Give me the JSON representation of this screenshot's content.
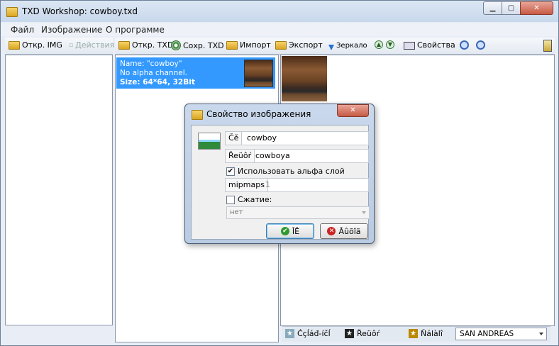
{
  "window": {
    "title": "TXD Workshop: cowboy.txd"
  },
  "menu": [
    "Файл",
    "Изображение",
    "О программе"
  ],
  "left_toolbar": {
    "open_img": "Откр. IMG",
    "actions": "Действия"
  },
  "main_toolbar": {
    "open_txd": "Откр. TXD",
    "save_txd": "Сохр. TXD",
    "import": "Импорт",
    "export": "Экспорт",
    "mirror": "Зеркало",
    "properties": "Свойства"
  },
  "texture_item": {
    "name": "Name: \"cowboy\"",
    "alpha": "No alpha channel.",
    "size": "Size: 64*64, 32Bit"
  },
  "status": {
    "tab1": "Ćçĺáđ-íčĺ",
    "tab2": "Řeüôŕ",
    "tab3": "Ňálàlî",
    "game": "SAN ANDREAS"
  },
  "dialog": {
    "title": "Свойство изображения",
    "name_label": "Čě",
    "name_value": "cowboy",
    "alpha_label": "Řeüôŕ",
    "alpha_value": "cowboya",
    "use_alpha_label": "Использовать альфа слой",
    "use_alpha_checked": true,
    "mipmaps_label": "mipmaps",
    "mipmaps_value": "1",
    "compress_label": "Сжатие:",
    "compress_checked": false,
    "compress_value": "нет",
    "ok_label": "ÎÊ",
    "cancel_label": "Âûõîä"
  }
}
